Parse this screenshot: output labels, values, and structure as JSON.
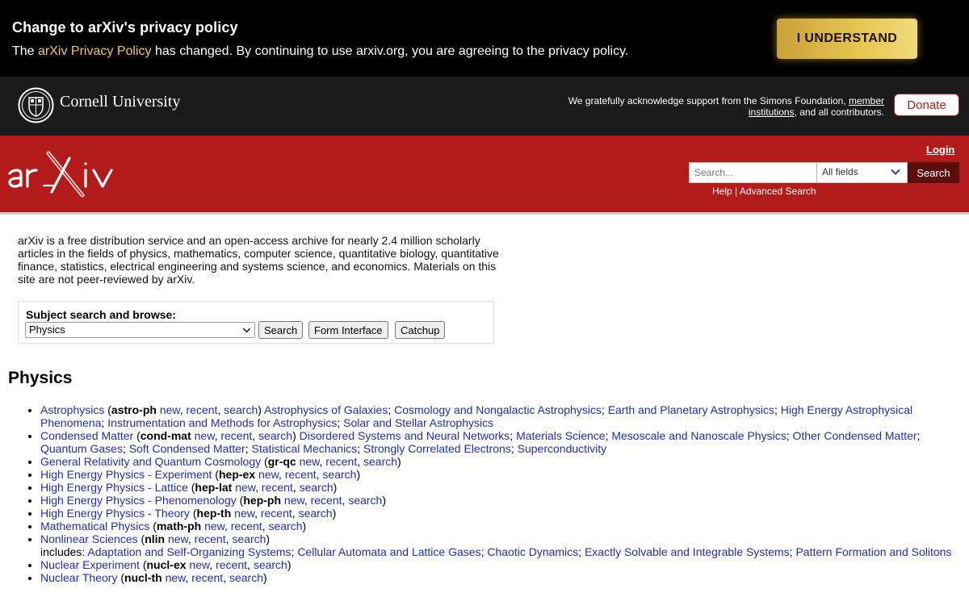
{
  "privacy_banner": {
    "title": "Change to arXiv's privacy policy",
    "text_prefix": "The ",
    "link": "arXiv Privacy Policy",
    "text_suffix": " has changed. By continuing to use arxiv.org, you are agreeing to the privacy policy.",
    "button": "I UNDERSTAND"
  },
  "cornell_bar": {
    "name": "Cornell University",
    "support_text": "We gratefully acknowledge support from the Simons Foundation, ",
    "support_link": "member institutions",
    "support_suffix": ", and all contributors.",
    "donate": "Donate"
  },
  "header": {
    "login": "Login",
    "search_placeholder": "Search...",
    "field_selected": "All fields",
    "search_button": "Search",
    "help": "Help",
    "separator": " | ",
    "advanced": "Advanced Search"
  },
  "intro": "arXiv is a free distribution service and an open-access archive for nearly 2.4 million scholarly articles in the fields of physics, mathematics, computer science, quantitative biology, quantitative finance, statistics, electrical engineering and systems science, and economics. Materials on this site are not peer-reviewed by arXiv.",
  "subject_search": {
    "label": "Subject search and browse:",
    "selected": "Physics",
    "buttons": [
      "Search",
      "Form Interface",
      "Catchup"
    ]
  },
  "section_title": "Physics",
  "archives": [
    {
      "name": "Astrophysics",
      "code": "astro-ph",
      "links": [
        "new",
        "recent",
        "search"
      ],
      "subs": [
        "Astrophysics of Galaxies",
        "Cosmology and Nongalactic Astrophysics",
        "Earth and Planetary Astrophysics",
        "High Energy Astrophysical Phenomena",
        "Instrumentation and Methods for Astrophysics",
        "Solar and Stellar Astrophysics"
      ]
    },
    {
      "name": "Condensed Matter",
      "code": "cond-mat",
      "links": [
        "new",
        "recent",
        "search"
      ],
      "subs": [
        "Disordered Systems and Neural Networks",
        "Materials Science",
        "Mesoscale and Nanoscale Physics",
        "Other Condensed Matter",
        "Quantum Gases",
        "Soft Condensed Matter",
        "Statistical Mechanics",
        "Strongly Correlated Electrons",
        "Superconductivity"
      ]
    },
    {
      "name": "General Relativity and Quantum Cosmology",
      "code": "gr-qc",
      "links": [
        "new",
        "recent",
        "search"
      ]
    },
    {
      "name": "High Energy Physics - Experiment",
      "code": "hep-ex",
      "links": [
        "new",
        "recent",
        "search"
      ]
    },
    {
      "name": "High Energy Physics - Lattice",
      "code": "hep-lat",
      "links": [
        "new",
        "recent",
        "search"
      ]
    },
    {
      "name": "High Energy Physics - Phenomenology",
      "code": "hep-ph",
      "links": [
        "new",
        "recent",
        "search"
      ]
    },
    {
      "name": "High Energy Physics - Theory",
      "code": "hep-th",
      "links": [
        "new",
        "recent",
        "search"
      ]
    },
    {
      "name": "Mathematical Physics",
      "code": "math-ph",
      "links": [
        "new",
        "recent",
        "search"
      ]
    },
    {
      "name": "Nonlinear Sciences",
      "code": "nlin",
      "links": [
        "new",
        "recent",
        "search"
      ],
      "includes_label": "includes:",
      "subs": [
        "Adaptation and Self-Organizing Systems",
        "Cellular Automata and Lattice Gases",
        "Chaotic Dynamics",
        "Exactly Solvable and Integrable Systems",
        "Pattern Formation and Solitons"
      ]
    },
    {
      "name": "Nuclear Experiment",
      "code": "nucl-ex",
      "links": [
        "new",
        "recent",
        "search"
      ]
    },
    {
      "name": "Nuclear Theory",
      "code": "nucl-th",
      "links": [
        "new",
        "recent",
        "search"
      ]
    }
  ],
  "colors": {
    "banner_bg": "#000000",
    "cornell_bg": "#1b1b1b",
    "arxiv_red": "#b31b1b",
    "link_blue": "#1f2fb3",
    "gold": "#e7c650"
  }
}
